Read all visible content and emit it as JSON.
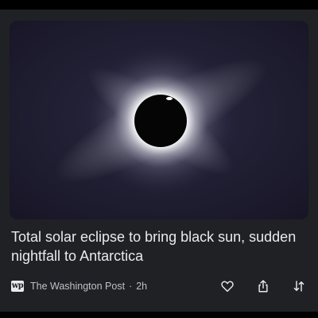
{
  "article": {
    "headline": "Total solar eclipse to bring black sun, sudden nightfall to Antarctica",
    "image_alt": "Total solar eclipse with glowing corona",
    "source_logo_text": "wp",
    "source_name": "The Washington Post",
    "separator": "·",
    "age": "2h"
  },
  "actions": {
    "like_icon": "heart-outline-icon",
    "share_icon": "share-icon",
    "more_icon": "see-more-less-icon"
  },
  "colors": {
    "background": "#202125",
    "headline_text": "#e8eaed",
    "meta_text": "#bdc1c6",
    "icon": "#e8eaed"
  }
}
